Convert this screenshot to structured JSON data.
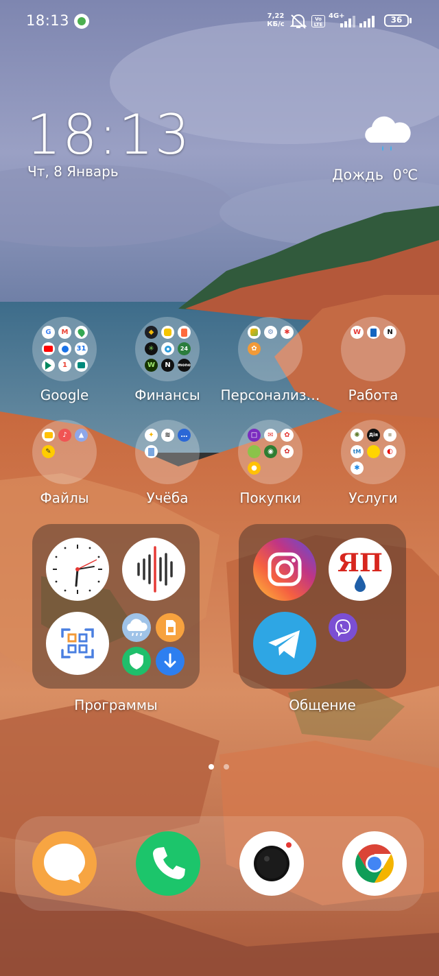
{
  "status_bar": {
    "time": "18:13",
    "net_speed": "7,22",
    "net_speed_unit": "КБ/с",
    "volte": "Vo LTE",
    "network_type": "4G+",
    "battery_level": "36"
  },
  "clock_widget": {
    "time": "18:13",
    "date": "Чт, 8 Январь"
  },
  "weather_widget": {
    "condition": "Дождь",
    "temperature": "0℃",
    "icon": "rain-cloud-icon"
  },
  "folders": {
    "google": "Google",
    "finance": "Финансы",
    "personalization": "Персонализ…",
    "work": "Работа",
    "files": "Файлы",
    "study": "Учёба",
    "shopping": "Покупки",
    "services": "Услуги"
  },
  "finance_minis": {
    "a24": "24",
    "mono": "mono"
  },
  "work_minis": {
    "notion": "N"
  },
  "services_minis": {
    "dia": "Дія"
  },
  "big_folders": {
    "programs": "Программы",
    "communication": "Общение"
  },
  "app_texts": {
    "yap_logo": "ЯП"
  },
  "page_indicator": {
    "pages": 2,
    "current_page": 1
  },
  "dock": {
    "apps": [
      "messages-icon",
      "phone-icon",
      "camera-icon",
      "chrome-icon"
    ]
  },
  "colors": {
    "sky": "#8a90b5",
    "sea": "#3f6d86",
    "rocks": "#d8703f",
    "phone_green": "#1cc56b",
    "telegram_blue": "#2ea6e4",
    "messages_orange": "#f7a542"
  }
}
